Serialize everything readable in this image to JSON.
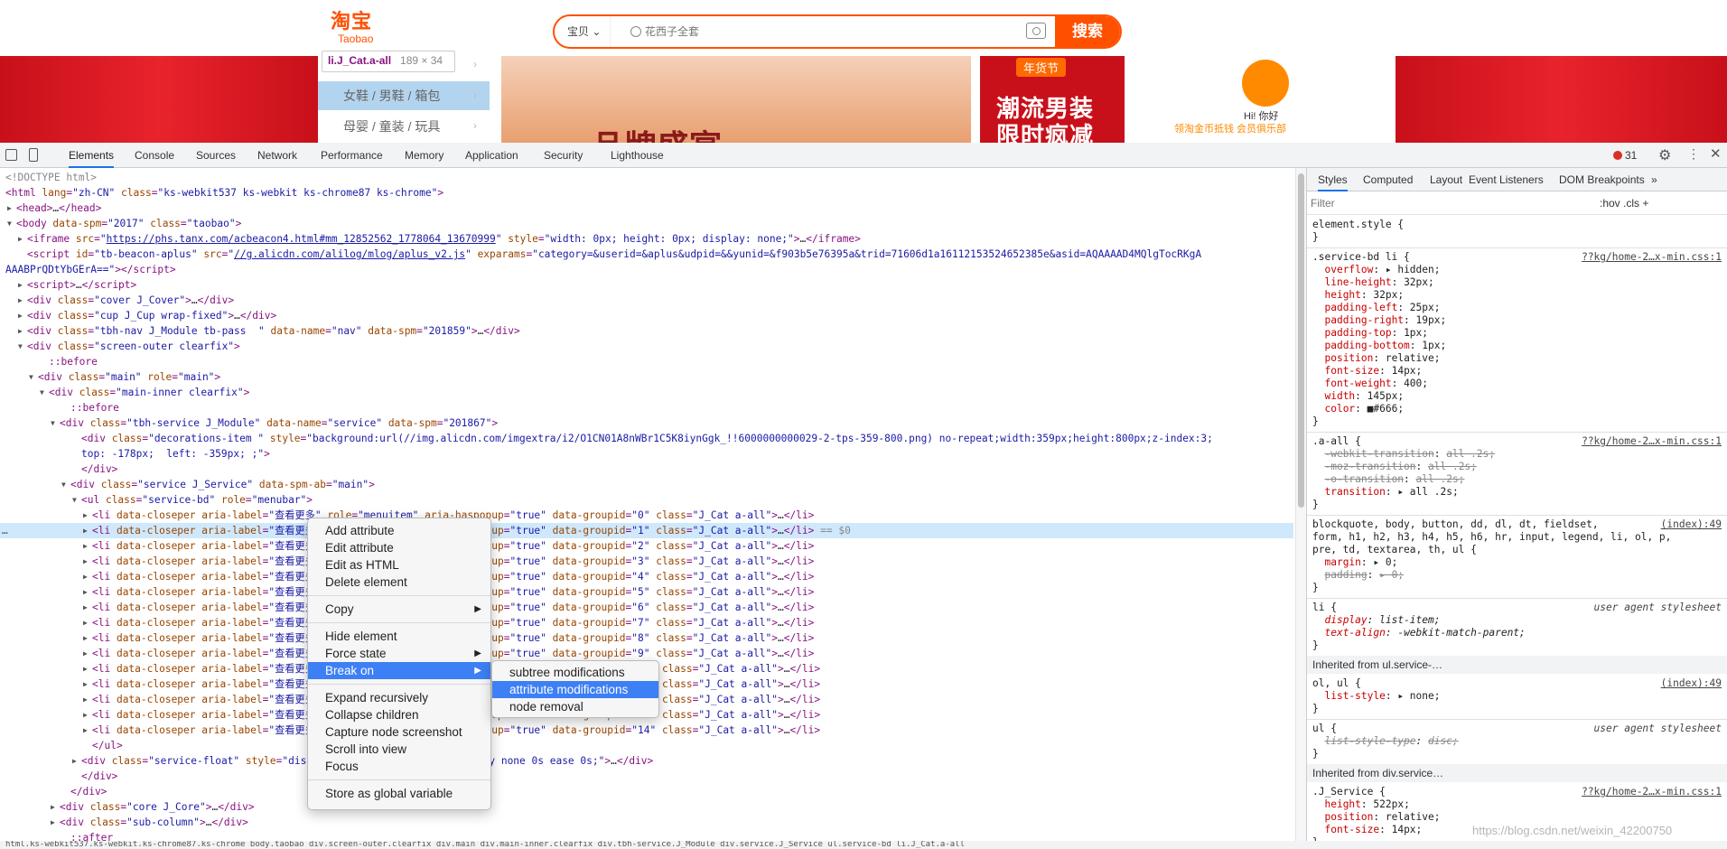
{
  "page": {
    "logo_cn": "淘宝",
    "logo_en": "Taobao",
    "search_category": "宝贝 ⌄",
    "search_placeholder": "花西子全套",
    "search_button": "搜索",
    "tooltip_tag": "li.J_Cat.a-all",
    "tooltip_size": "189 × 34",
    "service_items": [
      "女鞋 / 男鞋 / 箱包",
      "母婴 / 童装 / 玩具"
    ],
    "promo_text": "品牌盛宴",
    "promo2_tag": "年货节",
    "promo2_line1": "潮流男装",
    "promo2_line2": "限时疯减",
    "hi_text": "Hi! 你好",
    "user_links": "领淘金币抵钱   会员俱乐部"
  },
  "devtools": {
    "tabs": [
      "Elements",
      "Console",
      "Sources",
      "Network",
      "Performance",
      "Memory",
      "Application",
      "Security",
      "Lighthouse"
    ],
    "active_tab": "Elements",
    "error_count": "31",
    "styles_tabs": [
      "Styles",
      "Computed",
      "Layout",
      "Event Listeners",
      "DOM Breakpoints",
      "»"
    ],
    "filter_placeholder": "Filter",
    "hov_cls": ":hov  .cls  +",
    "breadcrumb": "html.ks-webkit537.ks-webkit.ks-chrome87.ks-chrome   body.taobao   div.screen-outer.clearfix   div.main   div.main-inner.clearfix   div.tbh-service.J_Module   div.service.J_Service   ul.service-bd   li.J_Cat.a-all",
    "watermark": "https://blog.csdn.net/weixin_42200750"
  },
  "dom_lines": [
    {
      "i": 0,
      "a": "",
      "h": "<span class='cm'>&lt;!DOCTYPE html&gt;</span>"
    },
    {
      "i": 0,
      "a": "",
      "h": "&lt;html <span class='an'>lang</span>=<span class='av'>\"zh-CN\"</span> <span class='an'>class</span>=<span class='av'>\"ks-webkit537 ks-webkit ks-chrome87 ks-chrome\"</span>&gt;"
    },
    {
      "i": 1,
      "a": "▶",
      "h": "&lt;head&gt;<span class='tx'>…</span>&lt;/head&gt;"
    },
    {
      "i": 1,
      "a": "▼",
      "h": "&lt;body <span class='an'>data-spm</span>=<span class='av'>\"2017\"</span> <span class='an'>class</span>=<span class='av'>\"taobao\"</span>&gt;"
    },
    {
      "i": 2,
      "a": "▶",
      "h": "&lt;iframe <span class='an'>src</span>=<span class='av'>\"<span class='lk'>https://phs.tanx.com/acbeacon4.html#mm_12852562_1778064_13670999</span>\"</span> <span class='an'>style</span>=<span class='av'>\"width: 0px; height: 0px; display: none;\"</span>&gt;<span class='tx'>…</span>&lt;/iframe&gt;"
    },
    {
      "i": 2,
      "a": "",
      "h": "&lt;script <span class='an'>id</span>=<span class='av'>\"tb-beacon-aplus\"</span> <span class='an'>src</span>=<span class='av'>\"<span class='lk'>//g.alicdn.com/alilog/mlog/aplus_v2.js</span>\"</span> <span class='an'>exparams</span>=<span class='av'>\"category=&amp;userid=&amp;aplus&amp;udpid=&amp;&amp;yunid=&amp;f903b5e76395a&amp;trid=71606d1a16112153524652385e&amp;asid=AQAAAAD4MQlgTocRKgA</span>"
    },
    {
      "i": 0,
      "a": "",
      "h": "<span class='av'>AAABPrQDtYbGErA==\"</span>&gt;&lt;/script&gt;"
    },
    {
      "i": 2,
      "a": "▶",
      "h": "&lt;script&gt;<span class='tx'>…</span>&lt;/script&gt;"
    },
    {
      "i": 2,
      "a": "▶",
      "h": "&lt;div <span class='an'>class</span>=<span class='av'>\"cover J_Cover\"</span>&gt;<span class='tx'>…</span>&lt;/div&gt;"
    },
    {
      "i": 2,
      "a": "▶",
      "h": "&lt;div <span class='an'>class</span>=<span class='av'>\"cup J_Cup wrap-fixed\"</span>&gt;<span class='tx'>…</span>&lt;/div&gt;"
    },
    {
      "i": 2,
      "a": "▶",
      "h": "&lt;div <span class='an'>class</span>=<span class='av'>\"tbh-nav J_Module tb-pass  \"</span> <span class='an'>data-name</span>=<span class='av'>\"nav\"</span> <span class='an'>data-spm</span>=<span class='av'>\"201859\"</span>&gt;<span class='tx'>…</span>&lt;/div&gt;"
    },
    {
      "i": 2,
      "a": "▼",
      "h": "&lt;div <span class='an'>class</span>=<span class='av'>\"screen-outer clearfix\"</span>&gt;"
    },
    {
      "i": 4,
      "a": "",
      "h": "<span class='pseudo'>::before</span>"
    },
    {
      "i": 3,
      "a": "▼",
      "h": "&lt;div <span class='an'>class</span>=<span class='av'>\"main\"</span> <span class='an'>role</span>=<span class='av'>\"main\"</span>&gt;"
    },
    {
      "i": 4,
      "a": "▼",
      "h": "&lt;div <span class='an'>class</span>=<span class='av'>\"main-inner clearfix\"</span>&gt;"
    },
    {
      "i": 6,
      "a": "",
      "h": "<span class='pseudo'>::before</span>"
    },
    {
      "i": 5,
      "a": "▼",
      "h": "&lt;div <span class='an'>class</span>=<span class='av'>\"tbh-service J_Module\"</span> <span class='an'>data-name</span>=<span class='av'>\"service\"</span> <span class='an'>data-spm</span>=<span class='av'>\"201867\"</span>&gt;"
    },
    {
      "i": 7,
      "a": "",
      "h": "&lt;div <span class='an'>class</span>=<span class='av'>\"decorations-item \"</span> <span class='an'>style</span>=<span class='av'>\"background:url(//img.alicdn.com/imgextra/i2/O1CN01A8nWBr1C5K8iynGgk_!!6000000000029-2-tps-359-800.png) no-repeat;width:359px;height:800px;z-index:3;</span>"
    },
    {
      "i": 7,
      "a": "",
      "h": "<span class='av'>top: -178px;  left: -359px; ;\"</span>&gt;"
    },
    {
      "i": 7,
      "a": "",
      "h": "&lt;/div&gt;"
    },
    {
      "i": 6,
      "a": "▼",
      "h": "&lt;div <span class='an'>class</span>=<span class='av'>\"service J_Service\"</span> <span class='an'>data-spm-ab</span>=<span class='av'>\"main\"</span>&gt;"
    },
    {
      "i": 7,
      "a": "▼",
      "h": "&lt;ul <span class='an'>class</span>=<span class='av'>\"service-bd\"</span> <span class='an'>role</span>=<span class='av'>\"menubar\"</span>&gt;"
    },
    {
      "i": 8,
      "a": "▶",
      "h": "&lt;li <span class='an'>data-closeper</span> <span class='an'>aria-label</span>=<span class='av'>\"查看更多\"</span> <span class='an'>role</span>=<span class='av'>\"menuitem\"</span> <span class='an'>aria-haspopup</span>=<span class='av'>\"true\"</span> <span class='an'>data-groupid</span>=<span class='av'>\"0\"</span> <span class='an'>class</span>=<span class='av'>\"J_Cat a-all\"</span>&gt;<span class='tx'>…</span>&lt;/li&gt;"
    },
    {
      "i": 8,
      "a": "▶",
      "sel": true,
      "h": "&lt;li <span class='an'>data-closeper</span> <span class='an'>aria-label</span>=<span class='av'>\"查看更多\"</span> <span class='an'>role</span>=<span class='av'>\"menuitem\"</span> <span class='an'>aria-haspopup</span>=<span class='av'>\"true\"</span> <span class='an'>data-groupid</span>=<span class='av'>\"1\"</span> <span class='an'>class</span>=<span class='av'>\"J_Cat a-all\"</span>&gt;<span class='tx'>…</span>&lt;/li&gt; <span class='cm'>== $0</span>"
    },
    {
      "i": 8,
      "a": "▶",
      "h": "&lt;li <span class='an'>data-closeper</span> <span class='an'>aria-label</span>=<span class='av'>\"查看更多\"</span> <span class='an'>role</span>=<span class='av'>\"menuitem\"</span> <span class='an'>aria-haspopup</span>=<span class='av'>\"true\"</span> <span class='an'>data-groupid</span>=<span class='av'>\"2\"</span> <span class='an'>class</span>=<span class='av'>\"J_Cat a-all\"</span>&gt;<span class='tx'>…</span>&lt;/li&gt;"
    },
    {
      "i": 8,
      "a": "▶",
      "h": "&lt;li <span class='an'>data-closeper</span> <span class='an'>aria-label</span>=<span class='av'>\"查看更多\"</span> <span class='an'>role</span>=<span class='av'>\"menuitem\"</span> <span class='an'>aria-haspopup</span>=<span class='av'>\"true\"</span> <span class='an'>data-groupid</span>=<span class='av'>\"3\"</span> <span class='an'>class</span>=<span class='av'>\"J_Cat a-all\"</span>&gt;<span class='tx'>…</span>&lt;/li&gt;"
    },
    {
      "i": 8,
      "a": "▶",
      "h": "&lt;li <span class='an'>data-closeper</span> <span class='an'>aria-label</span>=<span class='av'>\"查看更多\"</span> <span class='an'>role</span>=<span class='av'>\"menuitem\"</span> <span class='an'>aria-haspopup</span>=<span class='av'>\"true\"</span> <span class='an'>data-groupid</span>=<span class='av'>\"4\"</span> <span class='an'>class</span>=<span class='av'>\"J_Cat a-all\"</span>&gt;<span class='tx'>…</span>&lt;/li&gt;"
    },
    {
      "i": 8,
      "a": "▶",
      "h": "&lt;li <span class='an'>data-closeper</span> <span class='an'>aria-label</span>=<span class='av'>\"查看更多\"</span> <span class='an'>role</span>=<span class='av'>\"menuitem\"</span> <span class='an'>aria-haspopup</span>=<span class='av'>\"true\"</span> <span class='an'>data-groupid</span>=<span class='av'>\"5\"</span> <span class='an'>class</span>=<span class='av'>\"J_Cat a-all\"</span>&gt;<span class='tx'>…</span>&lt;/li&gt;"
    },
    {
      "i": 8,
      "a": "▶",
      "h": "&lt;li <span class='an'>data-closeper</span> <span class='an'>aria-label</span>=<span class='av'>\"查看更多\"</span> <span class='an'>role</span>=<span class='av'>\"menuitem\"</span> <span class='an'>aria-haspopup</span>=<span class='av'>\"true\"</span> <span class='an'>data-groupid</span>=<span class='av'>\"6\"</span> <span class='an'>class</span>=<span class='av'>\"J_Cat a-all\"</span>&gt;<span class='tx'>…</span>&lt;/li&gt;"
    },
    {
      "i": 8,
      "a": "▶",
      "h": "&lt;li <span class='an'>data-closeper</span> <span class='an'>aria-label</span>=<span class='av'>\"查看更多\"</span> <span class='an'>role</span>=<span class='av'>\"menuitem\"</span> <span class='an'>aria-haspopup</span>=<span class='av'>\"true\"</span> <span class='an'>data-groupid</span>=<span class='av'>\"7\"</span> <span class='an'>class</span>=<span class='av'>\"J_Cat a-all\"</span>&gt;<span class='tx'>…</span>&lt;/li&gt;"
    },
    {
      "i": 8,
      "a": "▶",
      "h": "&lt;li <span class='an'>data-closeper</span> <span class='an'>aria-label</span>=<span class='av'>\"查看更多\"</span> <span class='an'>role</span>=<span class='av'>\"menuitem\"</span> <span class='an'>aria-haspopup</span>=<span class='av'>\"true\"</span> <span class='an'>data-groupid</span>=<span class='av'>\"8\"</span> <span class='an'>class</span>=<span class='av'>\"J_Cat a-all\"</span>&gt;<span class='tx'>…</span>&lt;/li&gt;"
    },
    {
      "i": 8,
      "a": "▶",
      "h": "&lt;li <span class='an'>data-closeper</span> <span class='an'>aria-label</span>=<span class='av'>\"查看更多\"</span> <span class='an'>role</span>=<span class='av'>\"menuitem\"</span> <span class='an'>aria-haspopup</span>=<span class='av'>\"true\"</span> <span class='an'>data-groupid</span>=<span class='av'>\"9\"</span> <span class='an'>class</span>=<span class='av'>\"J_Cat a-all\"</span>&gt;<span class='tx'>…</span>&lt;/li&gt;"
    },
    {
      "i": 8,
      "a": "▶",
      "h": "&lt;li <span class='an'>data-closeper</span> <span class='an'>aria-label</span>=<span class='av'>\"查看更多\"</span> <span class='an'>role</span>=<span class='av'>\"menuitem\"</span> <span class='an'>aria-haspopup</span>=<span class='av'>\"true\"</span> <span class='an'>data-groupid</span>=<span class='av'>\"10\"</span> <span class='an'>class</span>=<span class='av'>\"J_Cat a-all\"</span>&gt;<span class='tx'>…</span>&lt;/li&gt;"
    },
    {
      "i": 8,
      "a": "▶",
      "h": "&lt;li <span class='an'>data-closeper</span> <span class='an'>aria-label</span>=<span class='av'>\"查看更多\"</span> <span class='an'>role</span>=<span class='av'>\"menuitem\"</span> <span class='an'>aria-haspopup</span>=<span class='av'>\"true\"</span> <span class='an'>data-groupid</span>=<span class='av'>\"11\"</span> <span class='an'>class</span>=<span class='av'>\"J_Cat a-all\"</span>&gt;<span class='tx'>…</span>&lt;/li&gt;"
    },
    {
      "i": 8,
      "a": "▶",
      "h": "&lt;li <span class='an'>data-closeper</span> <span class='an'>aria-label</span>=<span class='av'>\"查看更多\"</span> <span class='an'>role</span>=<span class='av'>\"menuitem\"</span> <span class='an'>aria-haspopup</span>=<span class='av'>\"true\"</span> <span class='an'>data-groupid</span>=<span class='av'>\"12\"</span> <span class='an'>class</span>=<span class='av'>\"J_Cat a-all\"</span>&gt;<span class='tx'>…</span>&lt;/li&gt;"
    },
    {
      "i": 8,
      "a": "▶",
      "h": "&lt;li <span class='an'>data-closeper</span> <span class='an'>aria-label</span>=<span class='av'>\"查看更多\"</span> <span class='an'>role</span>=<span class='av'>\"menuitem\"</span> <span class='an'>aria-haspopup</span>=<span class='av'>\"true\"</span> <span class='an'>data-groupid</span>=<span class='av'>\"13\"</span> <span class='an'>class</span>=<span class='av'>\"J_Cat a-all\"</span>&gt;<span class='tx'>…</span>&lt;/li&gt;"
    },
    {
      "i": 8,
      "a": "▶",
      "h": "&lt;li <span class='an'>data-closeper</span> <span class='an'>aria-label</span>=<span class='av'>\"查看更多\"</span> <span class='an'>role</span>=<span class='av'>\"menuitem\"</span> <span class='an'>aria-haspopup</span>=<span class='av'>\"true\"</span> <span class='an'>data-groupid</span>=<span class='av'>\"14\"</span> <span class='an'>class</span>=<span class='av'>\"J_Cat a-all\"</span>&gt;<span class='tx'>…</span>&lt;/li&gt;"
    },
    {
      "i": 8,
      "a": "",
      "h": "&lt;/ul&gt;"
    },
    {
      "i": 7,
      "a": "▶",
      "h": "&lt;div <span class='an'>class</span>=<span class='av'>\"service-float\"</span> <span class='an'>style</span>=<span class='av'>\"display: none; transition: display none 0s ease 0s;\"</span>&gt;<span class='tx'>…</span>&lt;/div&gt;"
    },
    {
      "i": 7,
      "a": "",
      "h": "&lt;/div&gt;"
    },
    {
      "i": 6,
      "a": "",
      "h": "&lt;/div&gt;"
    },
    {
      "i": 5,
      "a": "▶",
      "h": "&lt;div <span class='an'>class</span>=<span class='av'>\"core J_Core\"</span>&gt;<span class='tx'>…</span>&lt;/div&gt;"
    },
    {
      "i": 5,
      "a": "▶",
      "h": "&lt;div <span class='an'>class</span>=<span class='av'>\"sub-column\"</span>&gt;<span class='tx'>…</span>&lt;/div&gt;"
    },
    {
      "i": 6,
      "a": "",
      "h": "<span class='pseudo'>::after</span>"
    }
  ],
  "context_menu": {
    "items": [
      {
        "label": "Add attribute",
        "sub": false
      },
      {
        "label": "Edit attribute",
        "sub": false
      },
      {
        "label": "Edit as HTML",
        "sub": false
      },
      {
        "label": "Delete element",
        "sub": false
      },
      {
        "sep": true
      },
      {
        "label": "Copy",
        "sub": true
      },
      {
        "sep": true
      },
      {
        "label": "Hide element",
        "sub": false
      },
      {
        "label": "Force state",
        "sub": true
      },
      {
        "label": "Break on",
        "sub": true,
        "hl": true
      },
      {
        "sep": true
      },
      {
        "label": "Expand recursively",
        "sub": false
      },
      {
        "label": "Collapse children",
        "sub": false
      },
      {
        "label": "Capture node screenshot",
        "sub": false
      },
      {
        "label": "Scroll into view",
        "sub": false
      },
      {
        "label": "Focus",
        "sub": false
      },
      {
        "sep": true
      },
      {
        "label": "Store as global variable",
        "sub": false
      }
    ],
    "submenu": [
      {
        "label": "subtree modifications"
      },
      {
        "label": "attribute modifications",
        "hl": true
      },
      {
        "label": "node removal"
      }
    ]
  },
  "styles": {
    "element_style": "element.style {\n}",
    "rule1_selector": ".service-bd li {",
    "rule1_src": "??kg/home-2…x-min.css:1",
    "rule1_props": [
      [
        "overflow",
        "▸ hidden;"
      ],
      [
        "line-height",
        "32px;"
      ],
      [
        "height",
        "32px;"
      ],
      [
        "padding-left",
        "25px;"
      ],
      [
        "padding-right",
        "19px;"
      ],
      [
        "padding-top",
        "1px;"
      ],
      [
        "padding-bottom",
        "1px;"
      ],
      [
        "position",
        "relative;"
      ],
      [
        "font-size",
        "14px;"
      ],
      [
        "font-weight",
        "400;"
      ],
      [
        "width",
        "145px;"
      ],
      [
        "color",
        "■#666;"
      ]
    ],
    "rule2_selector": ".a-all {",
    "rule2_src": "??kg/home-2…x-min.css:1",
    "rule2_props": [
      [
        "-webkit-transition",
        "all .2s;",
        true
      ],
      [
        "-moz-transition",
        "all .2s;",
        true
      ],
      [
        "-o-transition",
        "all .2s;",
        true
      ],
      [
        "transition",
        "▸ all .2s;",
        false
      ]
    ],
    "rule3_selector": "blockquote, body, button, dd, dl, dt, fieldset,\nform, h1, h2, h3, h4, h5, h6, hr, input, legend, li, ol, p,\npre, td, textarea, th, ul {",
    "rule3_src": "(index):49",
    "rule3_props": [
      [
        "margin",
        "▸ 0;",
        false
      ],
      [
        "padding",
        "▸ 0;",
        true
      ]
    ],
    "rule4_selector": "li {",
    "rule4_src": "user agent stylesheet",
    "rule4_props": [
      [
        "display",
        "list-item;"
      ],
      [
        "text-align",
        "-webkit-match-parent;"
      ]
    ],
    "inherit1": "Inherited from ul.service-…",
    "rule5_selector": "ol, ul {",
    "rule5_src": "(index):49",
    "rule5_props": [
      [
        "list-style",
        "▸ none;"
      ]
    ],
    "rule6_selector": "ul {",
    "rule6_src": "user agent stylesheet",
    "rule6_props": [
      [
        "list-style-type",
        "disc;"
      ]
    ],
    "inherit2": "Inherited from div.service…",
    "rule7_selector": ".J_Service {",
    "rule7_src": "??kg/home-2…x-min.css:1",
    "rule7_props": [
      [
        "height",
        "522px;"
      ],
      [
        "position",
        "relative;"
      ],
      [
        "font-size",
        "14px;"
      ]
    ]
  }
}
